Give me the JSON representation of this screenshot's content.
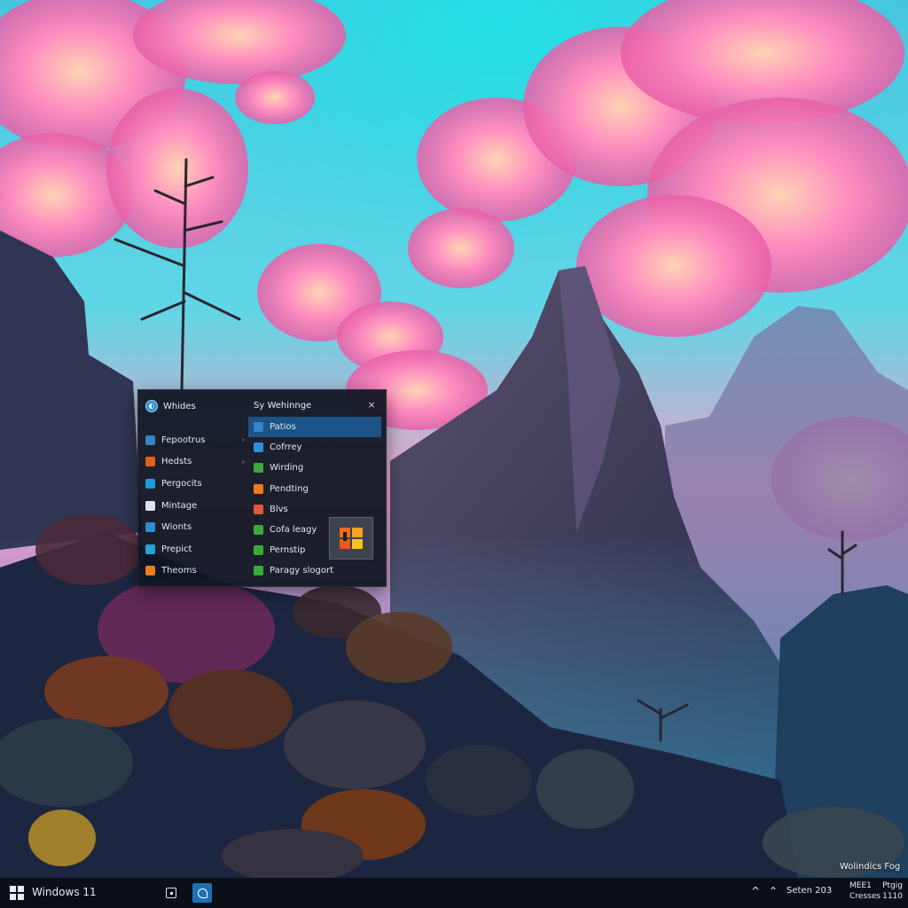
{
  "desktop": {
    "watermark": "Wolindics Fog"
  },
  "start_menu": {
    "left_header": {
      "title": "Whides",
      "icon": "app-logo-icon"
    },
    "right_header": {
      "title": "Sy Wehinnge"
    },
    "close_label": "×",
    "left_items": [
      {
        "label": "Fepootrus",
        "icon": "app-icon",
        "color": "#3b82c4"
      },
      {
        "label": "Hedsts",
        "icon": "app-icon",
        "color": "#e0601e"
      },
      {
        "label": "Pergocits",
        "icon": "app-icon",
        "color": "#1a9ed8"
      },
      {
        "label": "Mintage",
        "icon": "app-icon",
        "color": "#dfe3e8"
      },
      {
        "label": "Wionts",
        "icon": "app-icon",
        "color": "#2a8fd3"
      },
      {
        "label": "Prepict",
        "icon": "app-icon",
        "color": "#2aa2d8"
      },
      {
        "label": "Theoms",
        "icon": "app-icon",
        "color": "#f07b1d"
      }
    ],
    "right_items": [
      {
        "label": "Patios",
        "icon": "app-icon",
        "color": "#3a86c9",
        "selected": true
      },
      {
        "label": "Cofrrey",
        "icon": "app-icon",
        "color": "#2e8fd8",
        "selected": false
      },
      {
        "label": "Wirding",
        "icon": "app-icon",
        "color": "#3cab3c",
        "selected": false
      },
      {
        "label": "Pendting",
        "icon": "app-icon",
        "color": "#f07b1d",
        "selected": false
      },
      {
        "label": "Blvs",
        "icon": "app-icon",
        "color": "#e05a3a",
        "selected": false
      },
      {
        "label": "Cofa leagy",
        "icon": "app-icon",
        "color": "#3cab3c",
        "selected": false
      },
      {
        "label": "Pernstip",
        "icon": "app-icon",
        "color": "#3cab3c",
        "selected": false
      },
      {
        "label": "Paragy slogort",
        "icon": "app-icon",
        "color": "#3cab3c",
        "selected": false
      }
    ],
    "preview_tile": {
      "icon": "office-app-icon"
    }
  },
  "taskbar": {
    "os_label": "Windows 11",
    "start_icon": "windows-logo-icon",
    "task_view_icon": "task-view-icon",
    "active_app_icon": "browser-icon",
    "tray": {
      "chevron": "^",
      "network": "⌃",
      "status": "Seten 203"
    },
    "clock": {
      "line1_left": "MEE1",
      "line1_right": "Ptgig",
      "line2_left": "Cresses",
      "line2_right": "1110"
    }
  }
}
